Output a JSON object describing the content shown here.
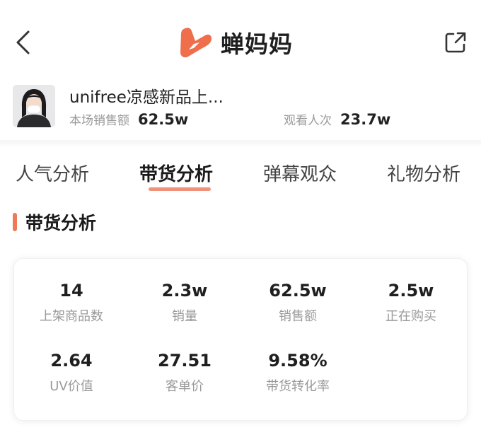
{
  "header": {
    "app_name": "蝉妈妈",
    "brand_color": "#ef6e4c"
  },
  "icons": {
    "back": "chevron-left-icon",
    "share": "share-icon",
    "logo": "chanmama-logo-icon"
  },
  "room": {
    "title": "unifree凉感新品上...",
    "sales_amount_label": "本场销售额",
    "sales_amount_value": "62.5w",
    "views_label": "观看人次",
    "views_value": "23.7w"
  },
  "tabs": [
    {
      "label": "人气分析",
      "active": false
    },
    {
      "label": "带货分析",
      "active": true
    },
    {
      "label": "弹幕观众",
      "active": false
    },
    {
      "label": "礼物分析",
      "active": false
    }
  ],
  "section": {
    "title": "带货分析",
    "accent_color": "#ef7a5a"
  },
  "metrics": [
    {
      "value": "14",
      "label": "上架商品数"
    },
    {
      "value": "2.3w",
      "label": "销量"
    },
    {
      "value": "62.5w",
      "label": "销售额"
    },
    {
      "value": "2.5w",
      "label": "正在购买"
    },
    {
      "value": "2.64",
      "label": "UV价值"
    },
    {
      "value": "27.51",
      "label": "客单价"
    },
    {
      "value": "9.58%",
      "label": "带货转化率"
    }
  ]
}
